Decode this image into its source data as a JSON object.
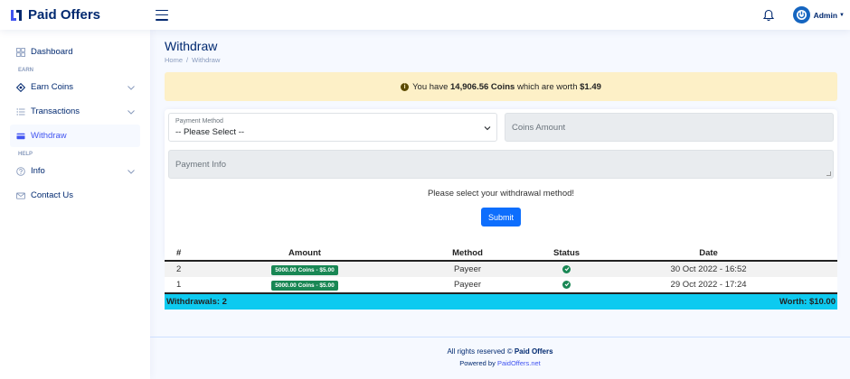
{
  "brand": {
    "name": "Paid Offers"
  },
  "header": {
    "profile_name": "Admin"
  },
  "sidebar": {
    "dashboard": "Dashboard",
    "heading_earn": "EARN",
    "earn_coins": "Earn Coins",
    "transactions": "Transactions",
    "withdraw": "Withdraw",
    "heading_help": "HELP",
    "info": "Info",
    "contact": "Contact Us"
  },
  "page": {
    "title": "Withdraw",
    "breadcrumb_home": "Home",
    "breadcrumb_sep": "/",
    "breadcrumb_current": "Withdraw"
  },
  "alert": {
    "prefix": "You have",
    "coins": "14,906.56 Coins",
    "middle": "which are worth",
    "worth": "$1.49"
  },
  "form": {
    "payment_method_label": "Payment Method",
    "payment_method_value": "-- Please Select --",
    "coins_amount_placeholder": "Coins Amount",
    "payment_info_placeholder": "Payment Info",
    "helper_text": "Please select your withdrawal method!",
    "submit_label": "Submit"
  },
  "table": {
    "headers": [
      "#",
      "Amount",
      "Method",
      "Status",
      "Date"
    ],
    "rows": [
      {
        "num": "2",
        "amount": "5000.00 Coins - $5.00",
        "method": "Payeer",
        "status": "completed",
        "date": "30 Oct 2022 - 16:52"
      },
      {
        "num": "1",
        "amount": "5000.00 Coins - $5.00",
        "method": "Payeer",
        "status": "completed",
        "date": "29 Oct 2022 - 17:24"
      }
    ],
    "footer_left": "Withdrawals: 2",
    "footer_right": "Worth: $10.00"
  },
  "footer": {
    "copyright_prefix": "All rights reserved ©",
    "copyright_brand": "Paid Offers",
    "powered_prefix": "Powered by",
    "powered_link": "PaidOffers.net"
  },
  "colors": {
    "brand": "#012970",
    "accent": "#4154f1",
    "alert_bg": "#fdf0c7",
    "badge_green": "#198754",
    "table_footer": "#0dcaf0",
    "submit": "#0d6efd"
  },
  "icons": {
    "logo": "logo-icon",
    "menu": "menu-icon",
    "bell": "bell-icon",
    "avatar": "power-icon",
    "dashboard": "grid-icon",
    "earn": "gem-icon",
    "transactions": "list-icon",
    "withdraw": "card-icon",
    "info": "question-icon",
    "contact": "envelope-icon",
    "status": "check-circle-icon"
  }
}
